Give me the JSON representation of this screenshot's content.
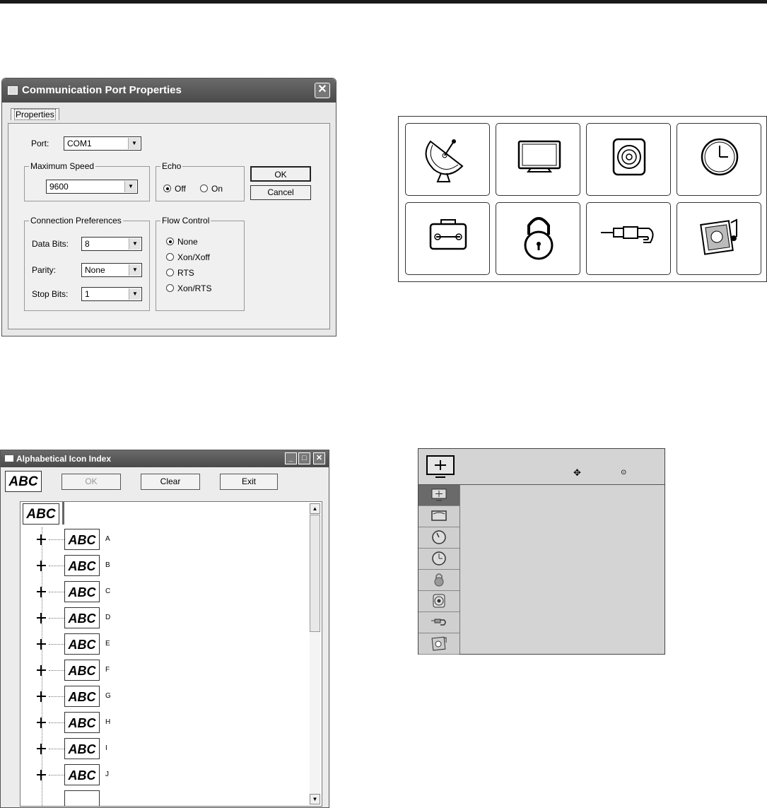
{
  "comm_dialog": {
    "title": "Communication Port Properties",
    "close_glyph": "✕",
    "tab": "Properties",
    "port_label": "Port:",
    "port_value": "COM1",
    "max_speed": {
      "group": "Maximum Speed",
      "value": "9600"
    },
    "echo": {
      "group": "Echo",
      "off": "Off",
      "on": "On",
      "selected": "Off"
    },
    "ok": "OK",
    "cancel": "Cancel",
    "connection": {
      "group": "Connection Preferences",
      "data_bits_label": "Data Bits:",
      "data_bits": "8",
      "parity_label": "Parity:",
      "parity": "None",
      "stop_bits_label": "Stop Bits:",
      "stop_bits": "1"
    },
    "flow_control": {
      "group": "Flow Control",
      "options": [
        "None",
        "Xon/Xoff",
        "RTS",
        "Xon/RTS"
      ],
      "selected": "None"
    }
  },
  "icon_grid": {
    "icons": [
      "satellite-dish-icon",
      "tv-icon",
      "speaker-icon",
      "clock-icon",
      "toolbox-icon",
      "padlock-icon",
      "av-cable-icon",
      "photo-music-icon"
    ]
  },
  "alpha_index": {
    "title": "Alphabetical Icon Index",
    "preview": "ABC",
    "ok": "OK",
    "clear": "Clear",
    "exit": "Exit",
    "root": "ABC",
    "letters": [
      "A",
      "B",
      "C",
      "D",
      "E",
      "F",
      "G",
      "H",
      "I",
      "J"
    ],
    "node_text": "ABC"
  },
  "osd_menu": {
    "items": [
      "picture-icon",
      "screen-icon",
      "timer-icon",
      "clock-icon",
      "lock-icon",
      "audio-icon",
      "input-icon",
      "media-icon"
    ],
    "selected_index": 0
  }
}
